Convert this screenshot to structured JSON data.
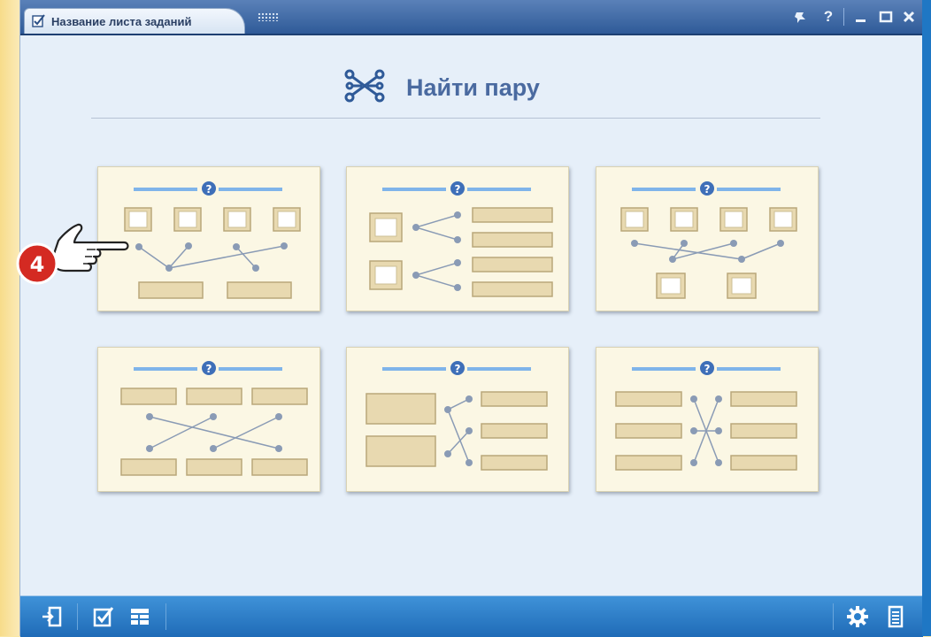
{
  "window": {
    "tab_title": "Название листа заданий",
    "controls": [
      "pin",
      "help",
      "minimize",
      "maximize",
      "close"
    ]
  },
  "header": {
    "title": "Найти пару",
    "icon": "connect-pairs-icon"
  },
  "templates": [
    {
      "name": "images-to-labels"
    },
    {
      "name": "two-images-to-four-labels"
    },
    {
      "name": "four-images-to-two-images"
    },
    {
      "name": "three-labels-to-three-labels"
    },
    {
      "name": "two-blocks-to-three-labels"
    },
    {
      "name": "three-labels-to-three-labels-column"
    }
  ],
  "callout": {
    "number": "4"
  },
  "bottombar": {
    "left_icons": [
      "exit-icon",
      "check-task-icon",
      "layout-icon"
    ],
    "right_icons": [
      "settings-icon",
      "list-icon"
    ]
  },
  "colors": {
    "titlebar": "#3a67a6",
    "panel": "#e6eff9",
    "card": "#fbf7e4",
    "connector": "#8a9bb5",
    "title_text": "#4a6aa0",
    "bottombar": "#2a7fcc",
    "callout_red": "#d42a22"
  }
}
